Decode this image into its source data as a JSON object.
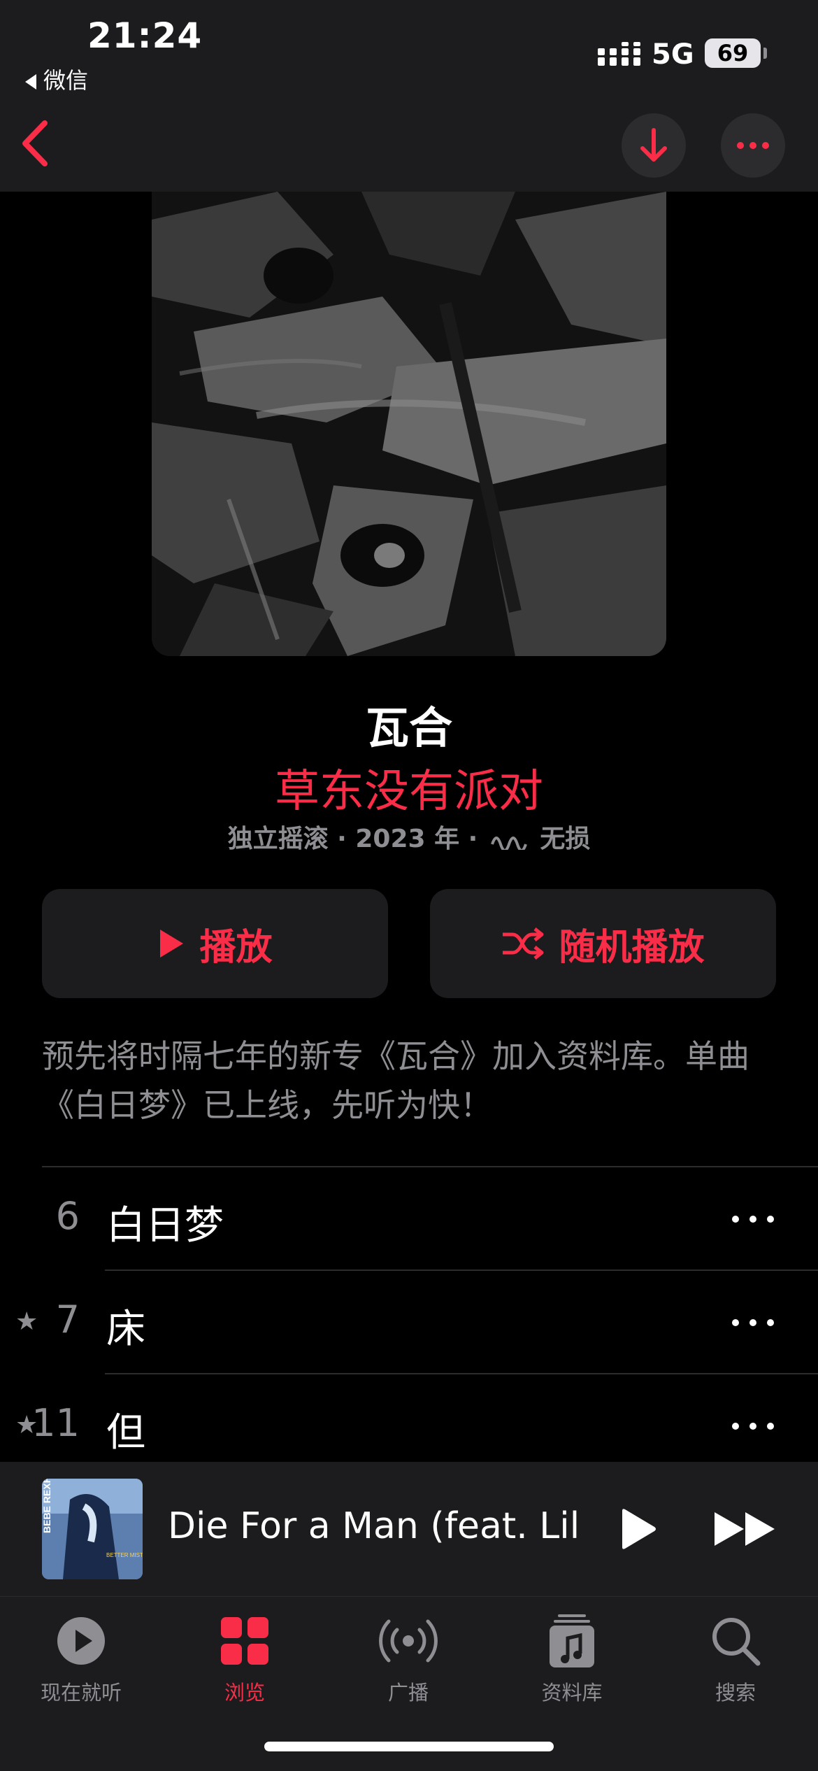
{
  "status_bar": {
    "time": "21:24",
    "back_app": "微信",
    "network": "5G",
    "battery": "69"
  },
  "nav": {
    "back_icon": "chevron-left-icon",
    "download_icon": "arrow-down-icon",
    "more_icon": "ellipsis-icon"
  },
  "album": {
    "title": "瓦合",
    "artist": "草东没有派对",
    "genre": "独立摇滚",
    "year": "2023 年",
    "quality": "无损",
    "play_label": "播放",
    "shuffle_label": "随机播放",
    "description": "预先将时隔七年的新专《瓦合》加入资料库。单曲《白日梦》已上线，先听为快！"
  },
  "tracks": [
    {
      "number": "6",
      "title": "白日梦",
      "starred": false
    },
    {
      "number": "7",
      "title": "床",
      "starred": true
    },
    {
      "number": "11",
      "title": "但",
      "starred": true
    }
  ],
  "mini_player": {
    "title": "Die For a Man (feat. Lil U...",
    "artwork_artist_text": "BEBE REXHA",
    "artwork_album_text": "BETTER MISTAKES"
  },
  "tabs": [
    {
      "label": "现在就听",
      "icon": "play-circle-icon",
      "active": false
    },
    {
      "label": "浏览",
      "icon": "grid-icon",
      "active": true
    },
    {
      "label": "广播",
      "icon": "broadcast-icon",
      "active": false
    },
    {
      "label": "资料库",
      "icon": "library-icon",
      "active": false
    },
    {
      "label": "搜索",
      "icon": "search-icon",
      "active": false
    }
  ],
  "colors": {
    "accent": "#fa2d48",
    "background": "#000000",
    "surface": "#1c1c1e",
    "secondary_text": "#8e8e93"
  }
}
